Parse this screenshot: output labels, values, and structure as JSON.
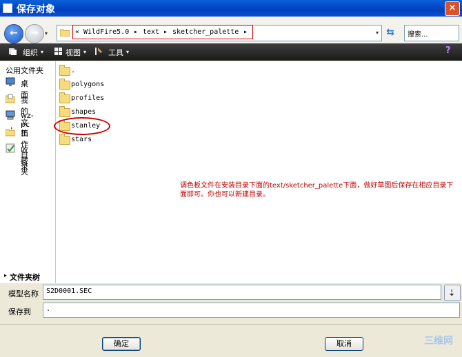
{
  "window": {
    "title": "保存对象",
    "close_glyph": "×"
  },
  "nav": {
    "back_glyph": "←",
    "forward_glyph": "→",
    "dropdown_glyph": "▾"
  },
  "address": {
    "prefix": "«",
    "crumbs": [
      "WildFire5.0",
      "text",
      "sketcher_palette"
    ],
    "separator": "▸",
    "dropdown_glyph": "▾",
    "refresh_glyph": "⇆"
  },
  "search": {
    "placeholder": "搜索..."
  },
  "toolbar": {
    "organize": "组织",
    "views": "视图",
    "tools": "工具",
    "dropdown_glyph": "▾",
    "help_glyph": "?"
  },
  "sidebar": {
    "header": "公用文件夹",
    "items": [
      {
        "label": "桌面",
        "icon": "desktop-icon"
      },
      {
        "label": "我的文档",
        "icon": "documents-icon"
      },
      {
        "label": "wz-pc",
        "icon": "computer-icon"
      },
      {
        "label": "工作目录",
        "icon": "work-folder-icon"
      },
      {
        "label": "收藏夹",
        "icon": "favorites-icon"
      }
    ]
  },
  "files": [
    {
      "name": "."
    },
    {
      "name": "polygons"
    },
    {
      "name": "profiles"
    },
    {
      "name": "shapes"
    },
    {
      "name": "stanley"
    },
    {
      "name": "stars"
    }
  ],
  "annotation": "调色板文件在安装目录下面的text/sketcher_palette下面，做好草图后保存在相应目录下面即可。你也可以新建目录。",
  "folder_tree": {
    "label": "文件夹树",
    "glyph": "▸"
  },
  "form": {
    "model_name_label": "模型名称",
    "model_name_value": "S2D0001.SEC",
    "save_to_label": "保存到",
    "save_to_value": "."
  },
  "buttons": {
    "ok": "确定",
    "cancel": "取消"
  },
  "watermark": "三维网",
  "colors": {
    "title_bar": "#0040c0",
    "toolbar": "#2a2a2a",
    "highlight_red": "#d00000",
    "annotation_red": "#c00000"
  }
}
